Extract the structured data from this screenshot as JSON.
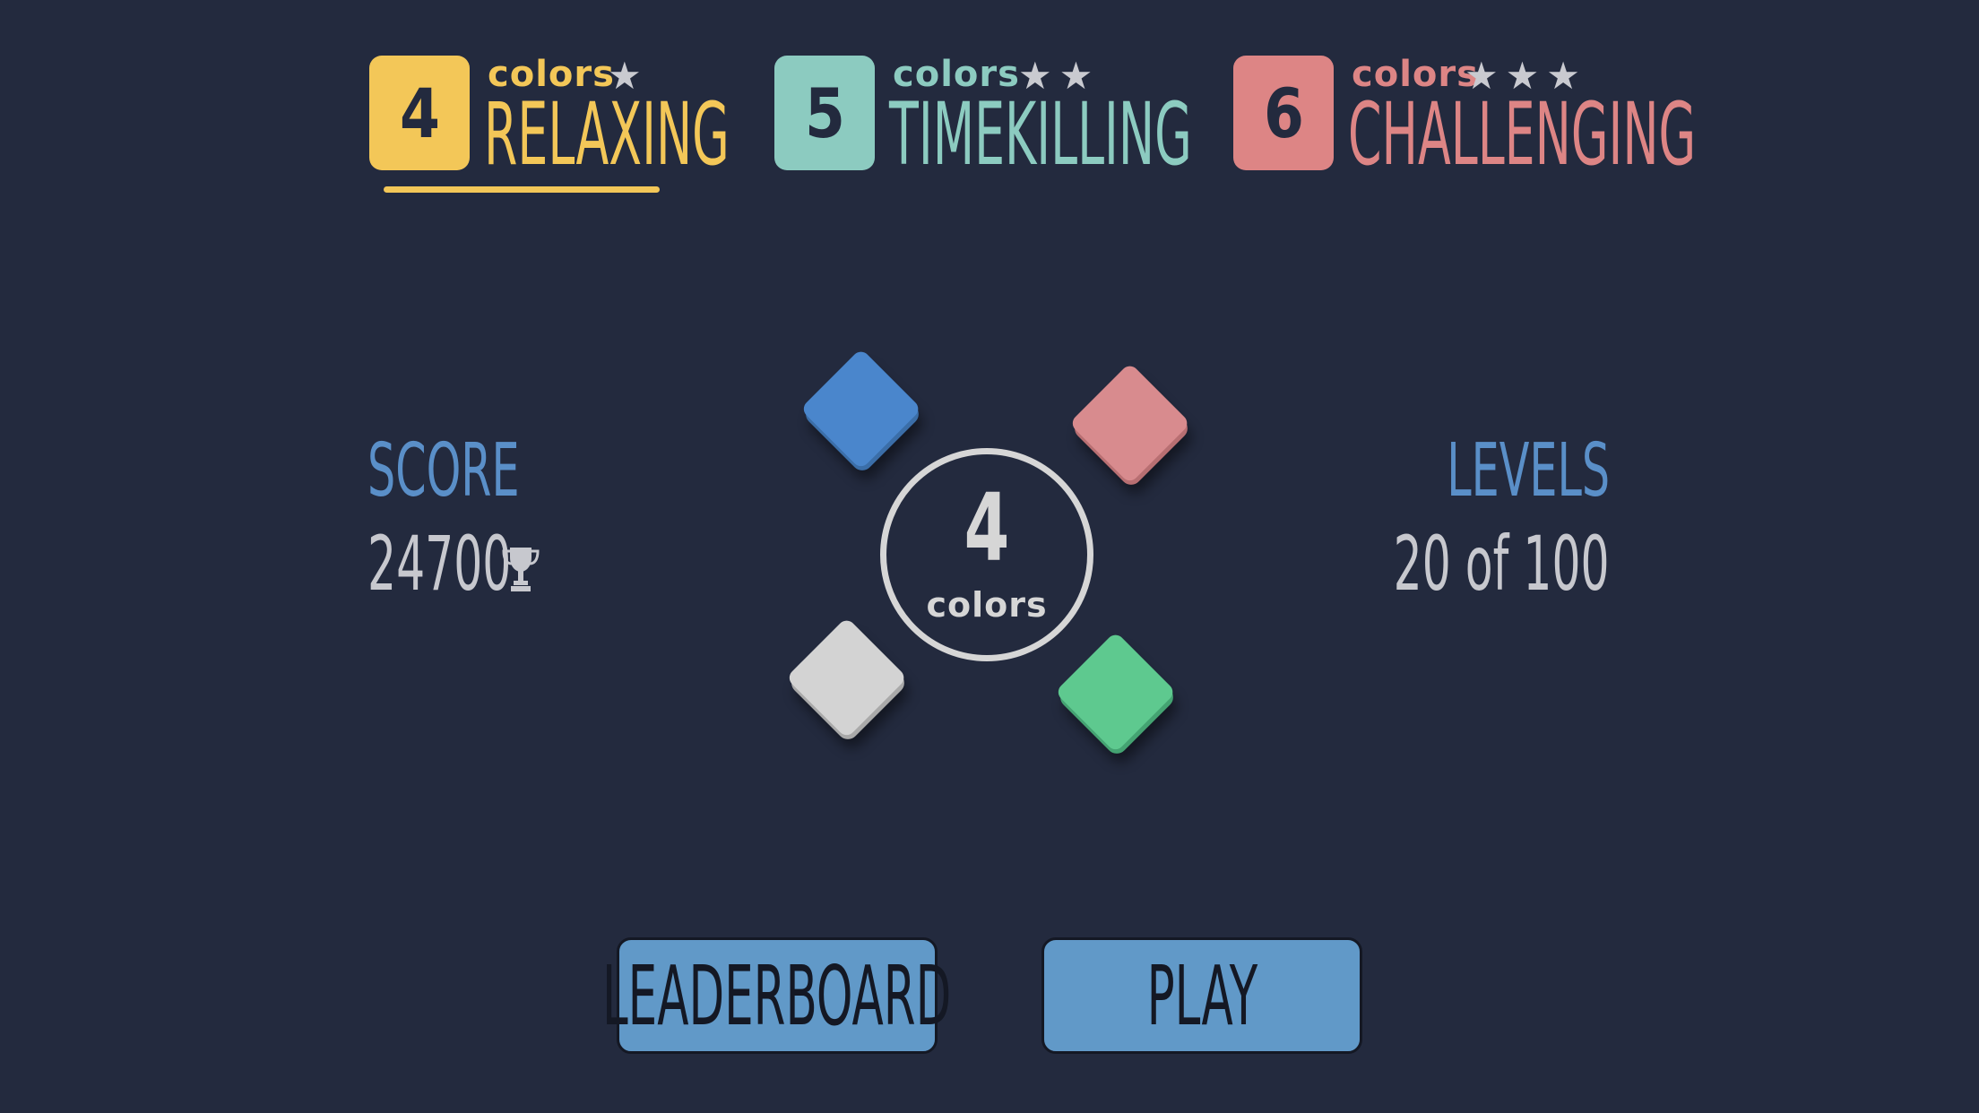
{
  "modes": [
    {
      "number": "4",
      "colors_label": "colors",
      "stars": "★",
      "name": "RELAXING",
      "color": "#f3c758",
      "selected": true
    },
    {
      "number": "5",
      "colors_label": "colors",
      "stars": "★★",
      "name": "TIMEKILLING",
      "color": "#8ccbc0",
      "selected": false
    },
    {
      "number": "6",
      "colors_label": "colors",
      "stars": "★★★",
      "name": "CHALLENGING",
      "color": "#dd8585",
      "selected": false
    }
  ],
  "score": {
    "label": "SCORE",
    "value": "24700",
    "icon": "trophy-icon"
  },
  "levels": {
    "label": "LEVELS",
    "value": "20 of 100"
  },
  "center": {
    "number": "4",
    "label": "colors"
  },
  "cubes": [
    {
      "name": "blue",
      "color": "#4a86cc"
    },
    {
      "name": "red",
      "color": "#d88b8e"
    },
    {
      "name": "white",
      "color": "#d3d3d3"
    },
    {
      "name": "green",
      "color": "#5ec98f"
    }
  ],
  "buttons": {
    "leaderboard": "LEADERBOARD",
    "play": "PLAY"
  },
  "theme": {
    "background": "#232a3e",
    "accent": "#5a8fc8",
    "button": "#6199c8"
  }
}
